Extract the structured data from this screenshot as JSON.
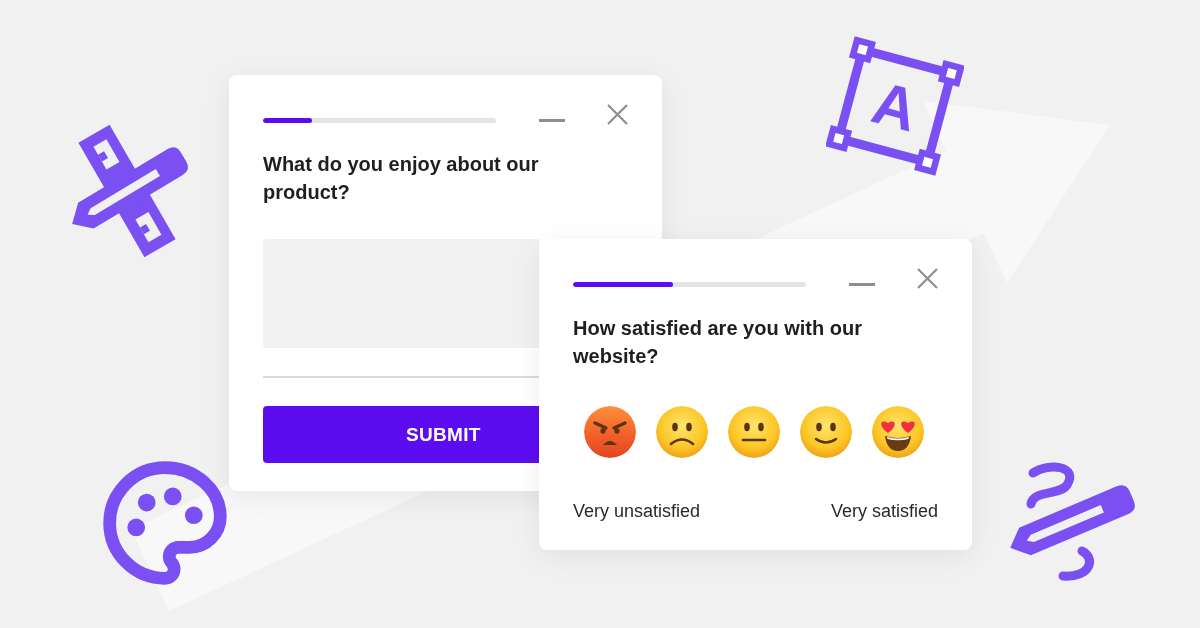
{
  "surveys": [
    {
      "kind": "text",
      "progress": {
        "level": 0.21
      },
      "question": "What do you enjoy about our product?",
      "submit_button": "SUBMIT"
    },
    {
      "kind": "rating",
      "progress": {
        "level": 0.43
      },
      "question": "How satisfied are you with our website?",
      "options": [
        {
          "kind": "angry",
          "selected": false
        },
        {
          "kind": "frowning",
          "selected": false
        },
        {
          "kind": "neutral",
          "selected": false
        },
        {
          "kind": "slight_smile",
          "selected": false
        },
        {
          "kind": "heart_eyes",
          "selected": false
        }
      ],
      "scale_labels": {
        "low": "Very unsatisfied",
        "high": "Very satisfied"
      }
    }
  ],
  "decorations": {
    "text_frame_letter": "A"
  }
}
